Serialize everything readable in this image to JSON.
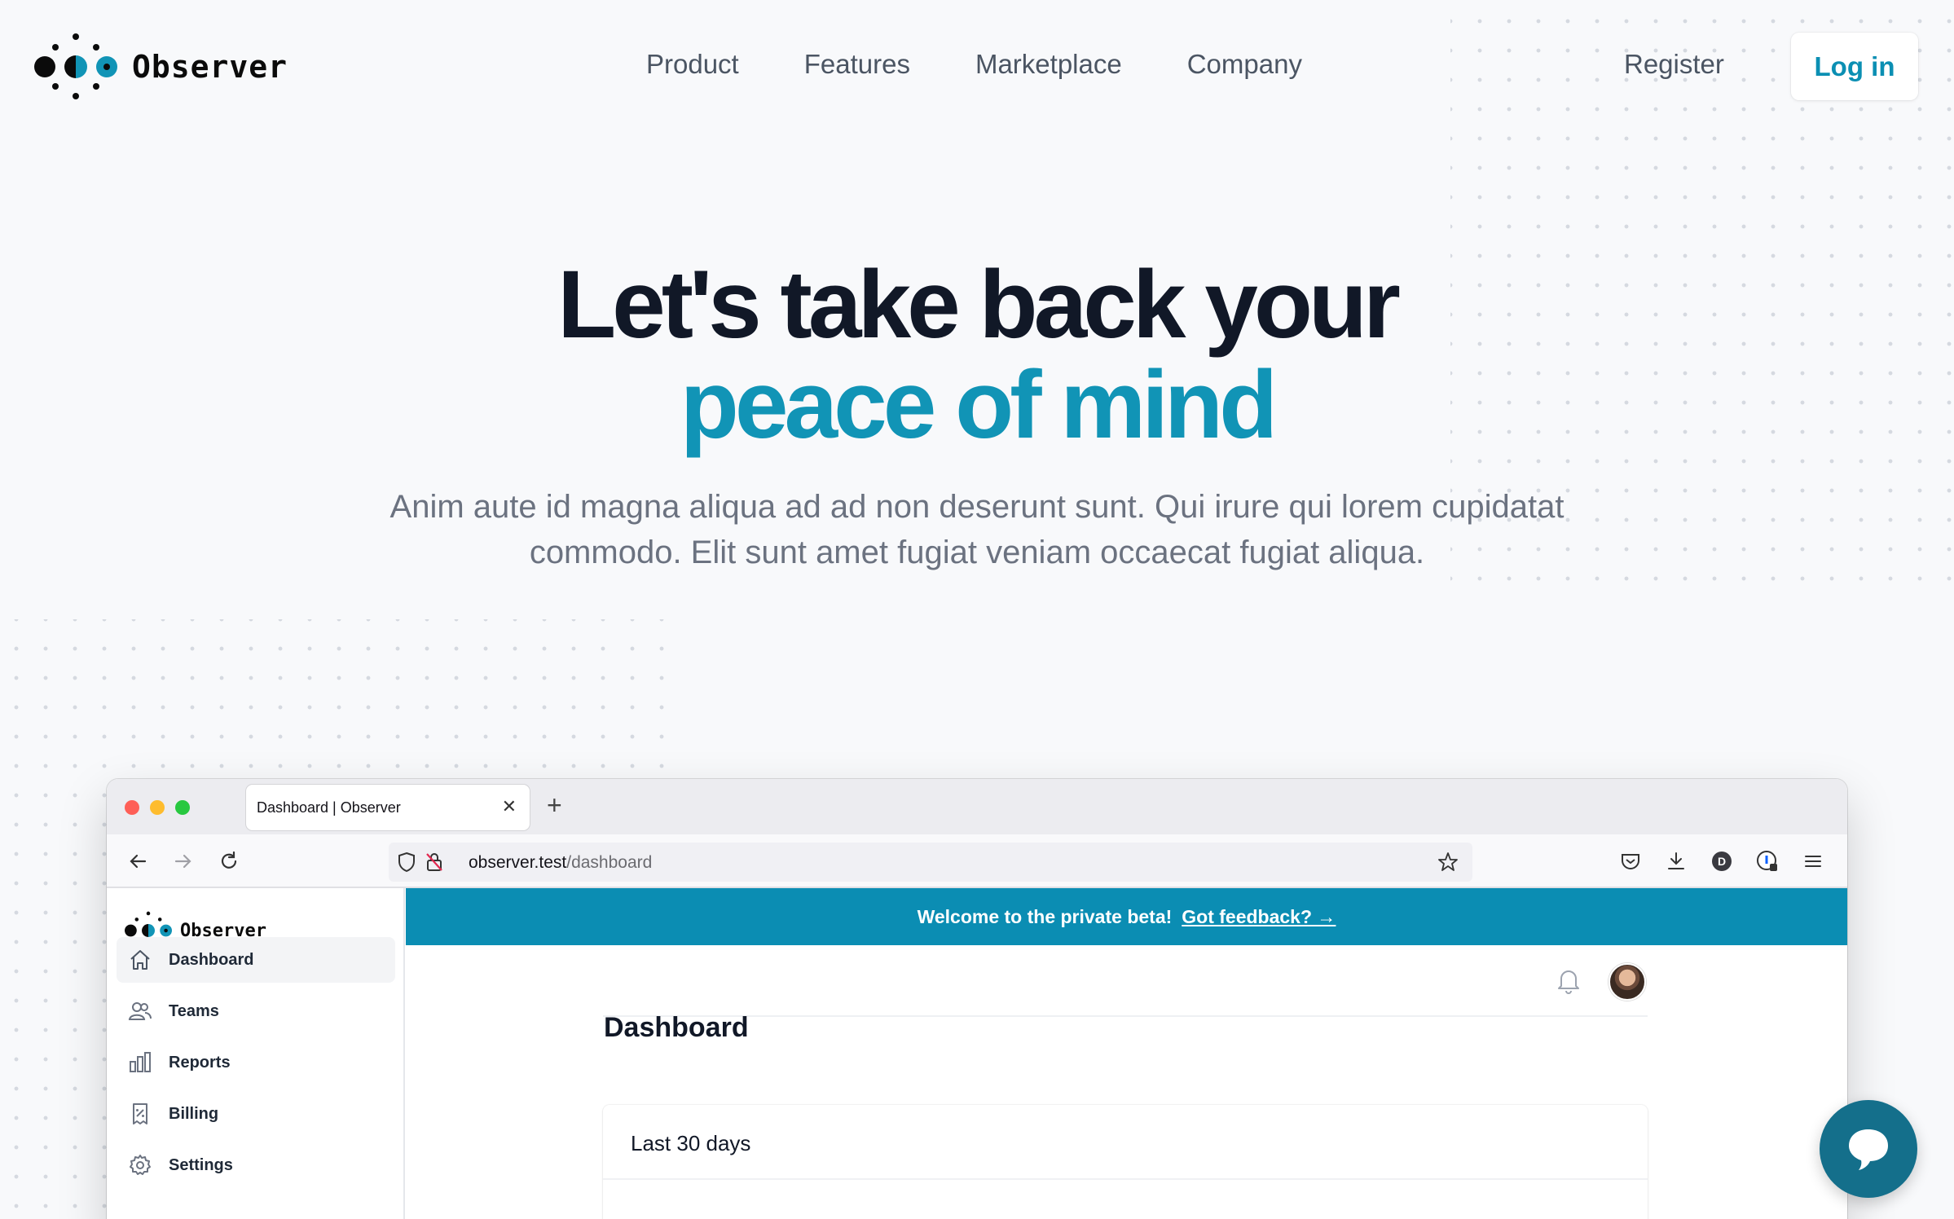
{
  "brand": {
    "name": "Observer",
    "accent": "#1194b6"
  },
  "nav": {
    "links": [
      "Product",
      "Features",
      "Marketplace",
      "Company"
    ],
    "register": "Register",
    "login": "Log in"
  },
  "hero": {
    "title_line1": "Let's take back your",
    "title_line2": "peace of mind",
    "subtitle": "Anim aute id magna aliqua ad ad non deserunt sunt. Qui irure qui lorem cupidatat commodo. Elit sunt amet fugiat veniam occaecat fugiat aliqua."
  },
  "browser": {
    "tab_title": "Dashboard | Observer",
    "url_host": "observer.test",
    "url_path": "/dashboard",
    "profile_initial": "D"
  },
  "app": {
    "brand": "Observer",
    "sidebar": [
      {
        "label": "Dashboard",
        "icon": "home-icon",
        "active": true
      },
      {
        "label": "Teams",
        "icon": "users-icon",
        "active": false
      },
      {
        "label": "Reports",
        "icon": "chart-bar-icon",
        "active": false
      },
      {
        "label": "Billing",
        "icon": "receipt-icon",
        "active": false
      },
      {
        "label": "Settings",
        "icon": "gear-icon",
        "active": false
      }
    ],
    "banner": {
      "text": "Welcome to the private beta!",
      "link": "Got feedback? →"
    },
    "page_title": "Dashboard",
    "card_title": "Last 30 days"
  }
}
